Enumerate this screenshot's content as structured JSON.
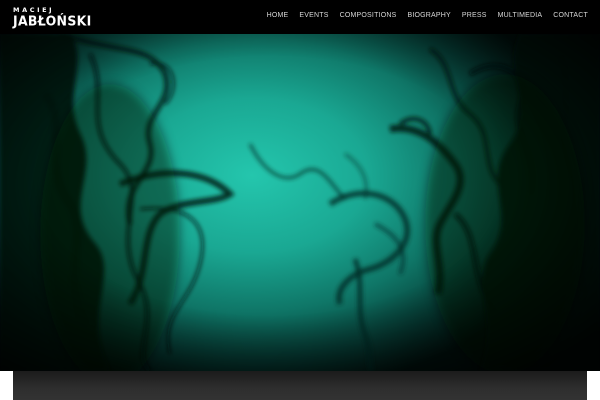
{
  "logo": {
    "line1": "MACIEJ",
    "line2": "JABŁOŃSKI"
  },
  "nav": {
    "items": [
      {
        "label": "HOME"
      },
      {
        "label": "EVENTS"
      },
      {
        "label": "COMPOSITIONS"
      },
      {
        "label": "BIOGRAPHY"
      },
      {
        "label": "PRESS"
      },
      {
        "label": "MULTIMEDIA"
      },
      {
        "label": "CONTACT"
      }
    ]
  },
  "colors": {
    "header_bg": "#000000",
    "nav_text": "#d8d8d8",
    "hero_teal": "#1fb8a0",
    "smoke": "#031512",
    "bottom_panel": "#2a2a2a"
  }
}
